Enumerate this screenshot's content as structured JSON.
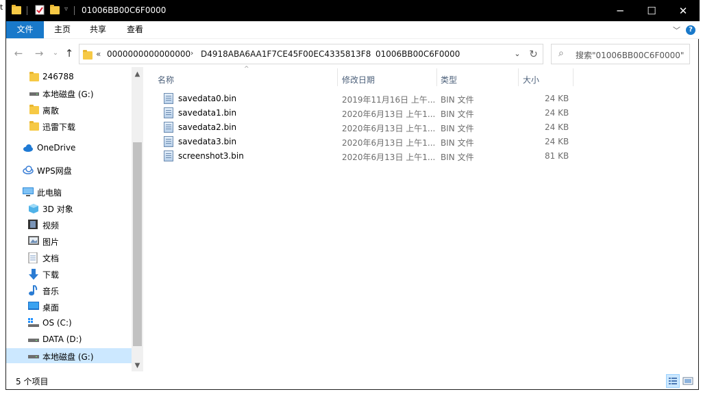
{
  "window": {
    "title": "01006BB00C6F0000",
    "controls": {
      "minimize": "─",
      "maximize": "☐",
      "close": "✕"
    },
    "edge_glyph": "t"
  },
  "ribbon": {
    "tabs": [
      "文件",
      "主页",
      "共享",
      "查看"
    ],
    "help": "?",
    "collapse": "﹀"
  },
  "address": {
    "overflow": "«",
    "crumbs": [
      "0000000000000000",
      "D4918ABA6AA1F7CE45F00EC4335813F8",
      "01006BB00C6F0000"
    ],
    "separator": "›",
    "dropdown": "⌄",
    "refresh": "↻"
  },
  "nav_buttons": {
    "back": "←",
    "forward": "→",
    "recent": "⌄",
    "up": "↑"
  },
  "search": {
    "placeholder": "搜索\"01006BB00C6F0000\"",
    "icon": "⌕"
  },
  "sidebar": {
    "items": [
      {
        "label": "246788",
        "icon": "folder-icon"
      },
      {
        "label": "本地磁盘 (G:)",
        "icon": "drive-icon"
      },
      {
        "label": "离散",
        "icon": "folder-icon"
      },
      {
        "label": "迅雷下载",
        "icon": "folder-icon"
      },
      {
        "label": "OneDrive",
        "icon": "cloud-icon"
      },
      {
        "label": "WPS网盘",
        "icon": "wps-cloud-icon"
      },
      {
        "label": "此电脑",
        "icon": "computer-icon"
      },
      {
        "label": "3D 对象",
        "icon": "cube-icon"
      },
      {
        "label": "视频",
        "icon": "video-icon"
      },
      {
        "label": "图片",
        "icon": "picture-icon"
      },
      {
        "label": "文档",
        "icon": "document-icon"
      },
      {
        "label": "下载",
        "icon": "download-icon"
      },
      {
        "label": "音乐",
        "icon": "music-icon"
      },
      {
        "label": "桌面",
        "icon": "desktop-icon"
      },
      {
        "label": "OS (C:)",
        "icon": "drive-icon"
      },
      {
        "label": "DATA (D:)",
        "icon": "drive-icon"
      },
      {
        "label": "本地磁盘 (G:)",
        "icon": "drive-icon"
      }
    ],
    "selected_index": 16,
    "scroll_up": "▲",
    "scroll_down": "▼"
  },
  "table": {
    "columns": [
      "名称",
      "修改日期",
      "类型",
      "大小"
    ],
    "sort_indicator": "^",
    "rows": [
      {
        "name": "savedata0.bin",
        "date": "2019年11月16日 上午...",
        "type": "BIN 文件",
        "size": "24 KB"
      },
      {
        "name": "savedata1.bin",
        "date": "2020年6月13日 上午1...",
        "type": "BIN 文件",
        "size": "24 KB"
      },
      {
        "name": "savedata2.bin",
        "date": "2020年6月13日 上午1...",
        "type": "BIN 文件",
        "size": "24 KB"
      },
      {
        "name": "savedata3.bin",
        "date": "2020年6月13日 上午1...",
        "type": "BIN 文件",
        "size": "24 KB"
      },
      {
        "name": "screenshot3.bin",
        "date": "2020年6月13日 上午1...",
        "type": "BIN 文件",
        "size": "81 KB"
      }
    ]
  },
  "status": {
    "item_count": "5 个项目"
  },
  "colors": {
    "accent": "#1979ca",
    "selection": "#cce8ff",
    "titlebar": "#000000",
    "folder": "#f6c945"
  }
}
